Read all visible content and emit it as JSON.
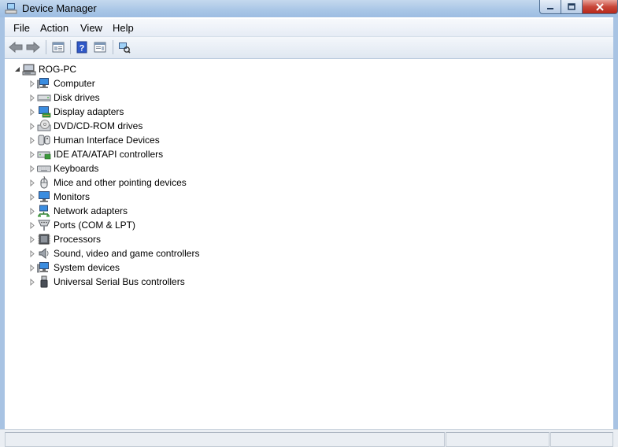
{
  "window": {
    "title": "Device Manager"
  },
  "menu": [
    "File",
    "Action",
    "View",
    "Help"
  ],
  "tree": {
    "root": "ROG-PC",
    "items": [
      {
        "label": "Computer",
        "icon": "computer-icon"
      },
      {
        "label": "Disk drives",
        "icon": "disk-drive-icon"
      },
      {
        "label": "Display adapters",
        "icon": "display-adapter-icon"
      },
      {
        "label": "DVD/CD-ROM drives",
        "icon": "dvd-drive-icon"
      },
      {
        "label": "Human Interface Devices",
        "icon": "hid-icon"
      },
      {
        "label": "IDE ATA/ATAPI controllers",
        "icon": "ide-controller-icon"
      },
      {
        "label": "Keyboards",
        "icon": "keyboard-icon"
      },
      {
        "label": "Mice and other pointing devices",
        "icon": "mouse-icon"
      },
      {
        "label": "Monitors",
        "icon": "monitor-icon"
      },
      {
        "label": "Network adapters",
        "icon": "network-adapter-icon"
      },
      {
        "label": "Ports (COM & LPT)",
        "icon": "port-icon"
      },
      {
        "label": "Processors",
        "icon": "processor-icon"
      },
      {
        "label": "Sound, video and game controllers",
        "icon": "speaker-icon"
      },
      {
        "label": "System devices",
        "icon": "system-device-icon"
      },
      {
        "label": "Universal Serial Bus controllers",
        "icon": "usb-icon"
      }
    ]
  }
}
